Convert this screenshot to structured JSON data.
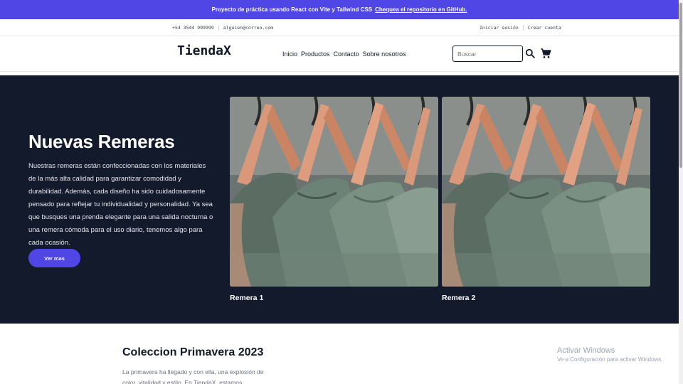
{
  "announcement": {
    "text": "Proyecto de práctica usando React con Vite y Tailwind CSS",
    "link": "Chequea el repositorio en GitHub."
  },
  "contact": {
    "phone": "+54 3544 999999",
    "email": "alguien@correo.com",
    "login": "Iniciar sesión",
    "register": "Crear cuenta"
  },
  "nav": {
    "logo": "TiendaX",
    "links": [
      "Inicio",
      "Productos",
      "Contacto",
      "Sobre nosotros"
    ],
    "search_placeholder": "Buscar",
    "icons": {
      "search": "search-icon",
      "cart": "cart-icon"
    }
  },
  "hero": {
    "title": "Nuevas Remeras",
    "description": "Nuestras remeras están confeccionadas con los materiales de la más alta calidad para garantizar comodidad y durabilidad. Además, cada diseño ha sido cuidadosamente pensado para reflejar tu individualidad y personalidad. Ya sea que busques una prenda elegante para una salida nocturna o una remera cómoda para el uso diario, tenemos algo para cada ocasión.",
    "cta": "Ver mas",
    "products": [
      {
        "name": "Remera 1"
      },
      {
        "name": "Remera 2"
      }
    ]
  },
  "collection": {
    "title": "Coleccion Primavera 2023",
    "text": "La primavera ha llegado y con ella, una explosión de color, vitalidad y estilo. En TiendaX, estamos emocionados de"
  },
  "windows_watermark": {
    "title": "Activar Windows",
    "subtitle": "Ve a Configuración para activar Windows."
  },
  "colors": {
    "accent": "#4f46e5",
    "hero_bg": "#131a2c"
  }
}
